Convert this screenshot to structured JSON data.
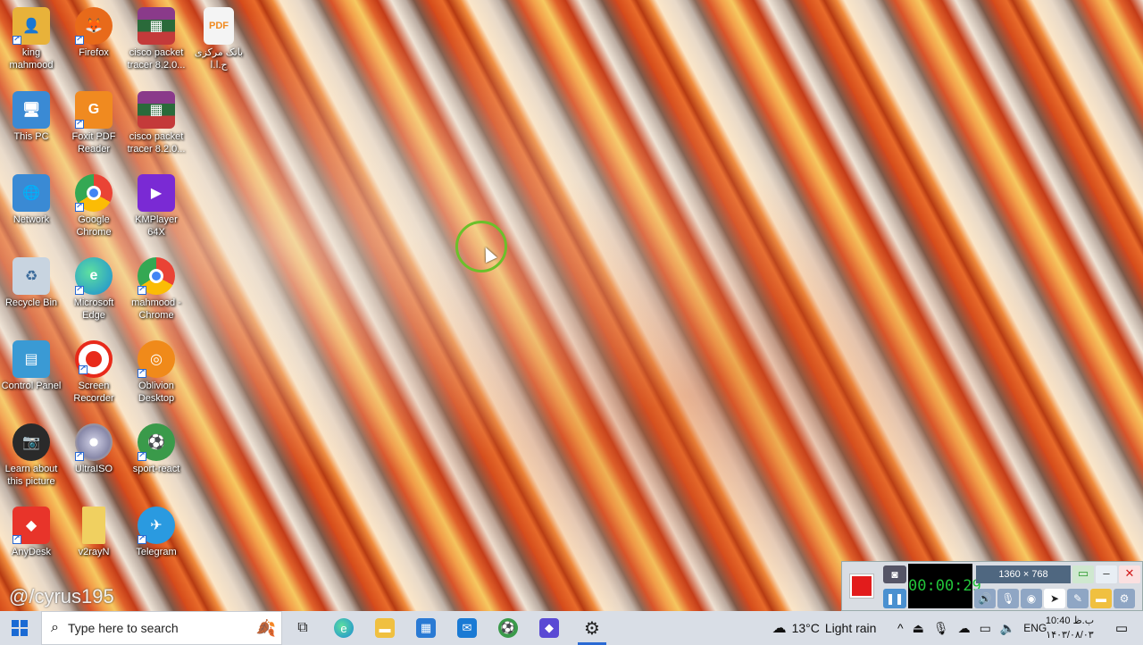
{
  "desktop": {
    "icons": [
      {
        "label": "king mahmood",
        "color": "#e8b23a",
        "glyph": "👤"
      },
      {
        "label": "Firefox",
        "color": "#e86a1a",
        "glyph": "🦊"
      },
      {
        "label": "cisco packet tracer 8.2.0...",
        "color": "#8a3a8a",
        "glyph": "▦"
      },
      {
        "label": "بانک مرکزی ج.ا.ا",
        "color": "#f4f4f4",
        "glyph": "PDF"
      },
      {
        "label": "This PC",
        "color": "#3a8ad4",
        "glyph": "🖥"
      },
      {
        "label": "Foxit PDF Reader",
        "color": "#f08a20",
        "glyph": "G"
      },
      {
        "label": "cisco packet tracer 8.2.0...",
        "color": "#8a3a8a",
        "glyph": "▦"
      },
      {
        "label": "Network",
        "color": "#3a8ad4",
        "glyph": "🌐"
      },
      {
        "label": "Google Chrome",
        "color": "#34a853",
        "glyph": "◉"
      },
      {
        "label": "KMPlayer 64X",
        "color": "#7a2ad4",
        "glyph": "▶"
      },
      {
        "label": "Recycle Bin",
        "color": "#c8d4e0",
        "glyph": "♻"
      },
      {
        "label": "Microsoft Edge",
        "color": "#1a8ad4",
        "glyph": "e"
      },
      {
        "label": "mahmood - Chrome",
        "color": "#e8443a",
        "glyph": "◉"
      },
      {
        "label": "Control Panel",
        "color": "#3a9ad4",
        "glyph": "▤"
      },
      {
        "label": "Screen Recorder",
        "color": "#e82a1a",
        "glyph": "⏺"
      },
      {
        "label": "Oblivion Desktop",
        "color": "#f08a1a",
        "glyph": "◎"
      },
      {
        "label": "Learn about this picture",
        "color": "#2a2a2a",
        "glyph": "📷"
      },
      {
        "label": "UltraISO",
        "color": "#a8a8b8",
        "glyph": "💿"
      },
      {
        "label": "sport-react",
        "color": "#3a9a4a",
        "glyph": "⚽"
      },
      {
        "label": "AnyDesk",
        "color": "#e8342a",
        "glyph": "◆"
      },
      {
        "label": "v2rayN",
        "color": "#f0d060",
        "glyph": "📁"
      },
      {
        "label": "Telegram",
        "color": "#2a9ae0",
        "glyph": "✈"
      }
    ],
    "watermark": "@/cyrus195"
  },
  "recorder": {
    "timer": "00:00:29",
    "resolution": "1360 × 768",
    "stop_icon": "stop-icon",
    "camera_icon": "camera-icon",
    "pause_icon": "pause-icon"
  },
  "taskbar": {
    "search_placeholder": "Type here to search",
    "apps": [
      "task-view",
      "edge",
      "file-explorer",
      "store",
      "mail",
      "sport-react",
      "app-cube",
      "settings"
    ],
    "weather": {
      "temp": "13°C",
      "condition": "Light rain"
    },
    "language": "ENG",
    "time": "10:40 ب.ظ",
    "date": "۱۴۰۳/۰۸/۰۳"
  },
  "colors": {
    "accent": "#2a6ad4",
    "record": "#e21c1c",
    "timer_text": "#22c43a"
  }
}
